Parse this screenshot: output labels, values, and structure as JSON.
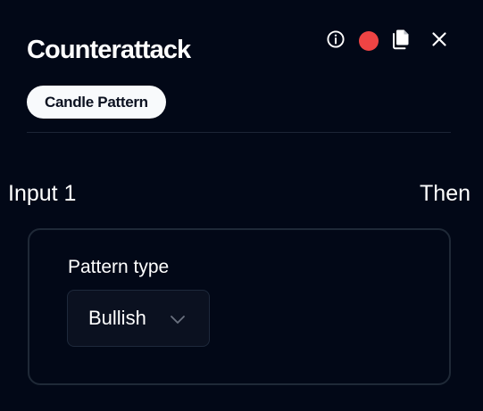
{
  "header": {
    "title": "Counterattack",
    "badge": "Candle Pattern",
    "toolbar": {
      "info_icon": "info-icon",
      "record_icon": "record-dot-icon",
      "copy_icon": "copy-icon",
      "close_icon": "close-icon",
      "record_color": "#ef4444"
    }
  },
  "connection": {
    "input_label": "Input 1",
    "output_label": "Then"
  },
  "config": {
    "pattern_type_label": "Pattern type",
    "pattern_type_value": "Bullish",
    "chevron_icon": "chevron-down-icon"
  },
  "colors": {
    "background": "#020817",
    "badge_bg": "#f8fafc",
    "card_border": "#1f2937",
    "select_bg": "#0b1120"
  }
}
